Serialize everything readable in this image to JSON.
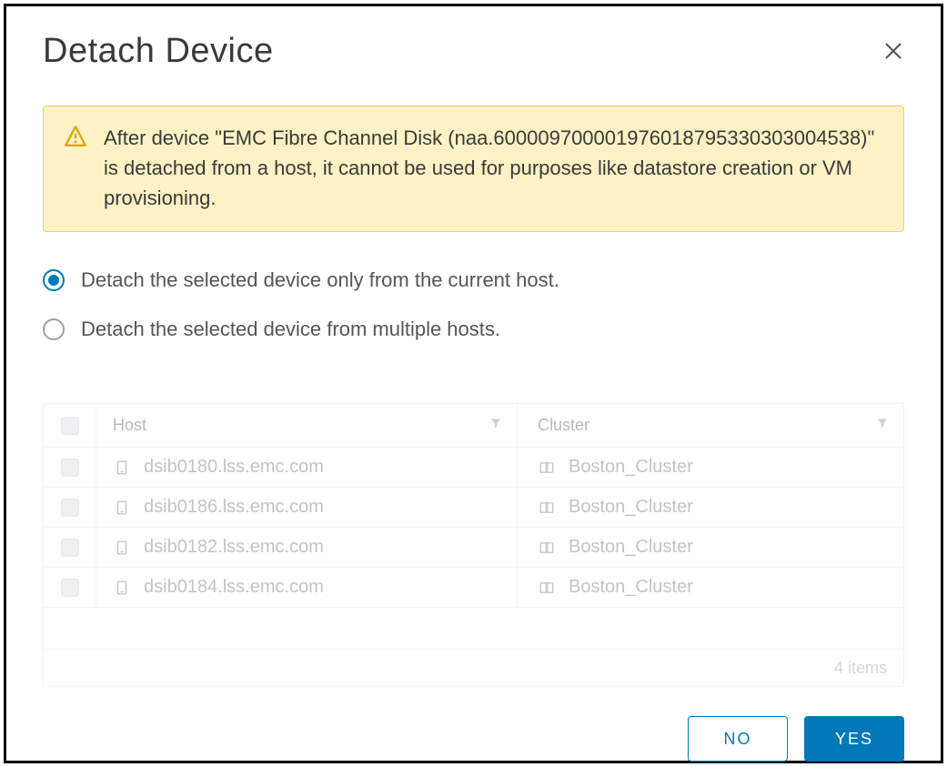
{
  "dialog": {
    "title": "Detach Device",
    "warning": "After device \"EMC Fibre Channel Disk (naa.600009700001976018795330303004538)\" is detached from a host, it cannot be used for purposes like datastore creation or VM provisioning."
  },
  "options": {
    "current_host": "Detach the selected device only from the current host.",
    "multiple_hosts": "Detach the selected device from multiple hosts.",
    "selected": "current_host"
  },
  "table": {
    "headers": {
      "host": "Host",
      "cluster": "Cluster"
    },
    "rows": [
      {
        "host": "dsib0180.lss.emc.com",
        "cluster": "Boston_Cluster"
      },
      {
        "host": "dsib0186.lss.emc.com",
        "cluster": "Boston_Cluster"
      },
      {
        "host": "dsib0182.lss.emc.com",
        "cluster": "Boston_Cluster"
      },
      {
        "host": "dsib0184.lss.emc.com",
        "cluster": "Boston_Cluster"
      }
    ],
    "footer": "4 items"
  },
  "actions": {
    "no": "NO",
    "yes": "YES"
  }
}
